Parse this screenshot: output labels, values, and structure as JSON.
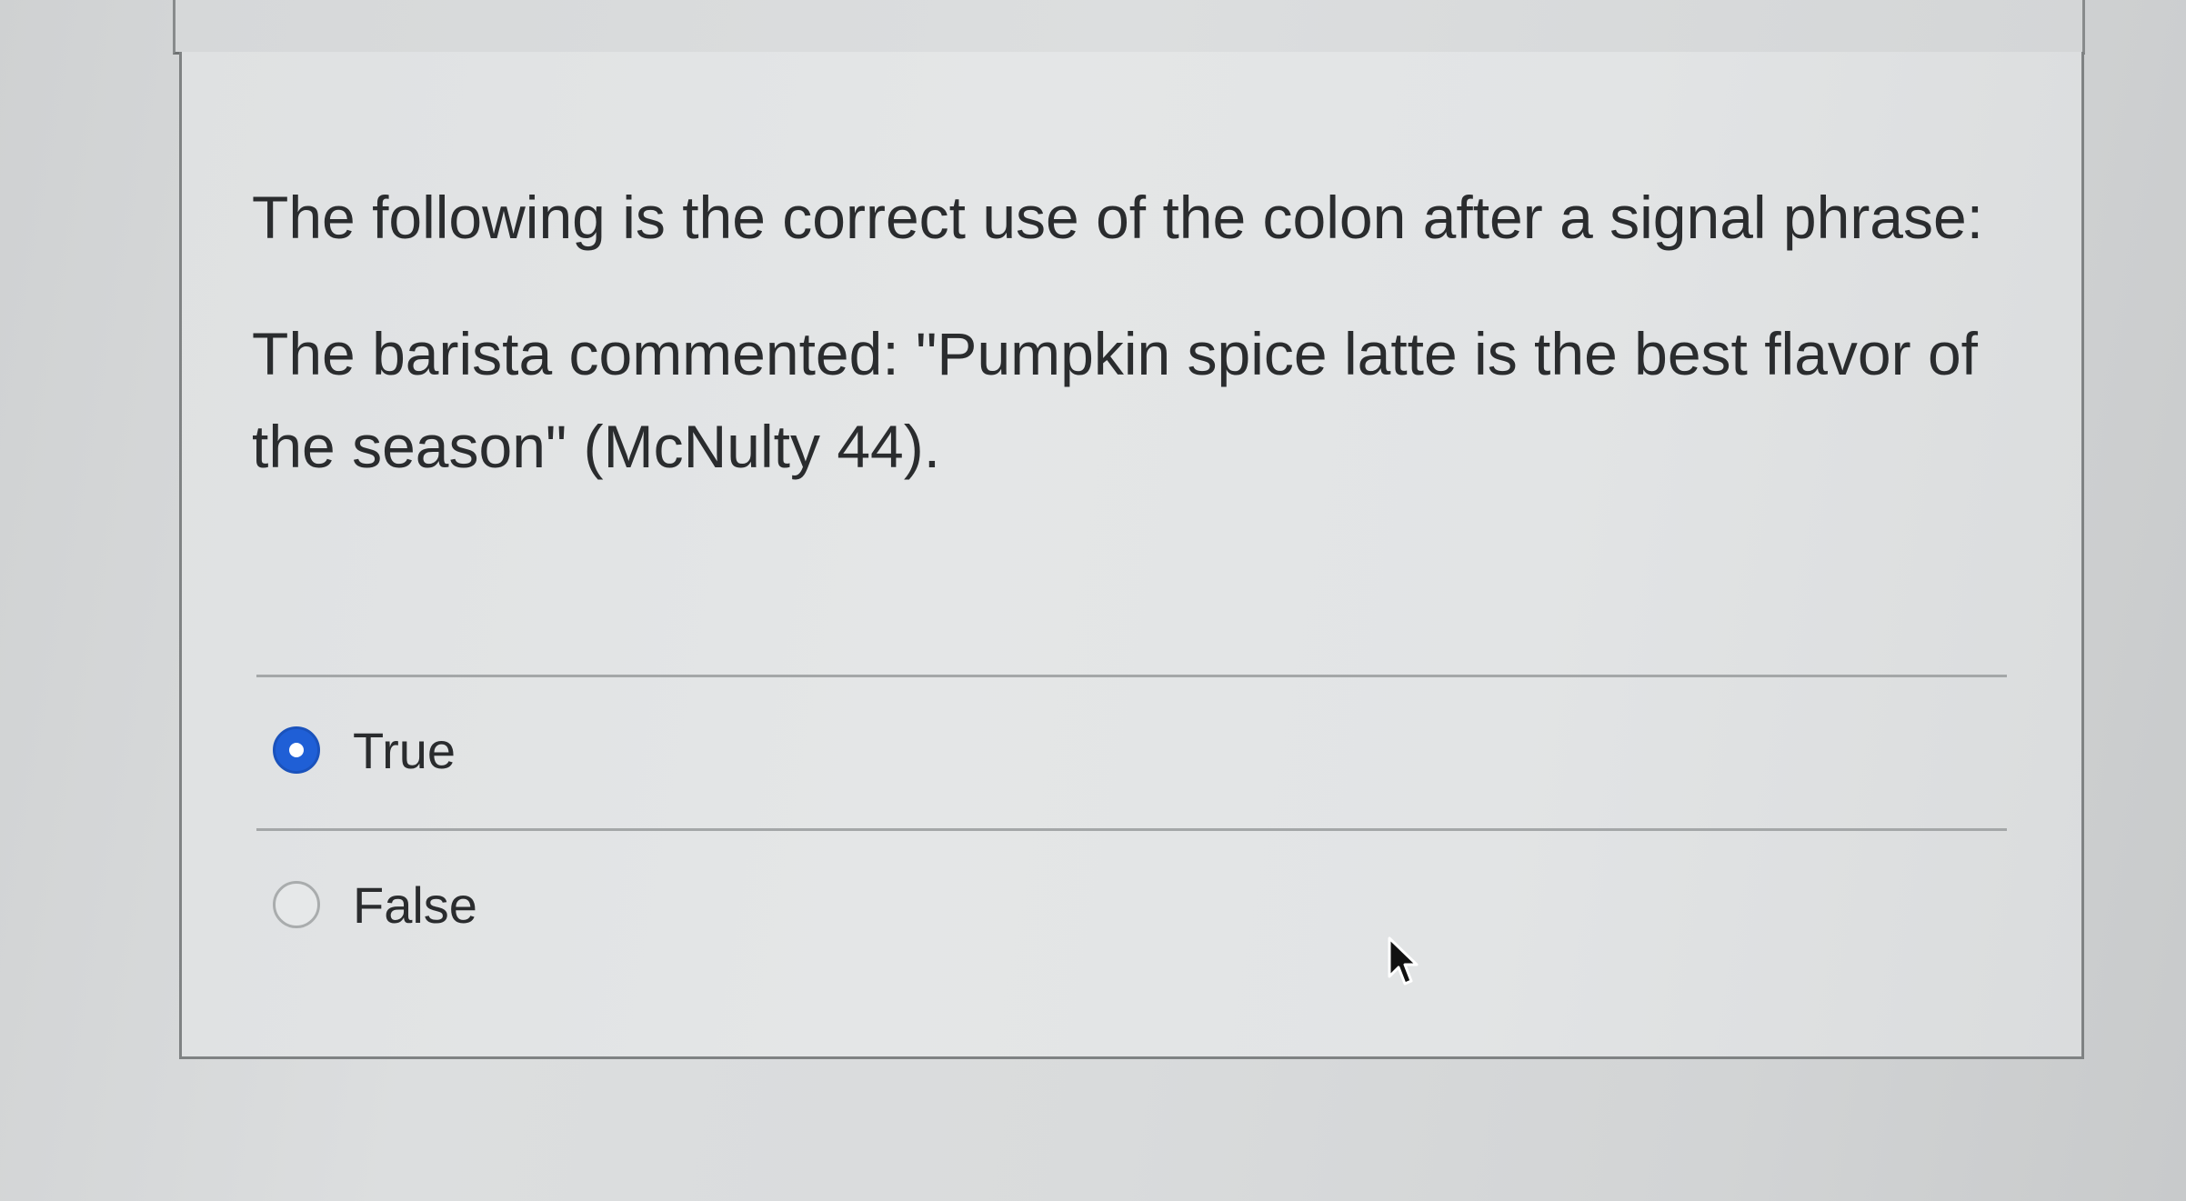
{
  "question": {
    "prompt": "The following is the correct use of the colon after a signal phrase:",
    "example": "The barista commented: \"Pumpkin spice latte is the best flavor of the season\" (McNulty 44)."
  },
  "answers": [
    {
      "label": "True",
      "selected": true
    },
    {
      "label": "False",
      "selected": false
    }
  ],
  "colors": {
    "accent": "#1f5fd6",
    "text": "#2a2c2e",
    "card_border": "#7f8283"
  },
  "icons": {
    "selected_radio": "radio-selected-icon",
    "unselected_radio": "radio-unselected-icon",
    "cursor": "mouse-pointer-icon"
  }
}
